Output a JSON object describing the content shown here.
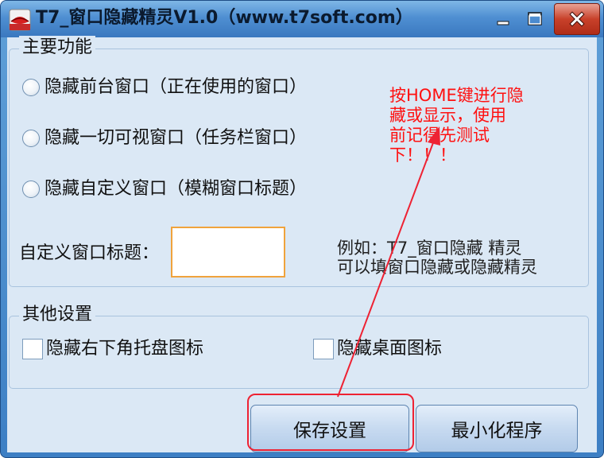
{
  "window": {
    "title": "T7_窗口隐藏精灵V1.0（www.t7soft.com）",
    "icon": "app-eye-icon"
  },
  "main_group": {
    "legend": "主要功能",
    "options": [
      {
        "label": "隐藏前台窗口（正在使用的窗口）",
        "checked": false
      },
      {
        "label": "隐藏一切可视窗口（任务栏窗口）",
        "checked": false
      },
      {
        "label": "隐藏自定义窗口（模糊窗口标题）",
        "checked": false
      }
    ],
    "custom_title_label": "自定义窗口标题：",
    "custom_title_value": "",
    "example_line1": "例如：T7_窗口隐藏 精灵",
    "example_line2": "可以填窗口隐藏或隐藏精灵",
    "hint_line1": "按HOME键进行隐",
    "hint_line2": "藏或显示，使用",
    "hint_line3": "前记得先测试",
    "hint_line4": "下！！！"
  },
  "other_group": {
    "legend": "其他设置",
    "hide_tray_label": "隐藏右下角托盘图标",
    "hide_tray_checked": false,
    "hide_desktop_label": "隐藏桌面图标",
    "hide_desktop_checked": false
  },
  "buttons": {
    "save": "保存设置",
    "minimize": "最小化程序"
  },
  "colors": {
    "annotation": "#ee2233",
    "input_border": "#f0a33c",
    "hint_text": "#ff1010"
  }
}
